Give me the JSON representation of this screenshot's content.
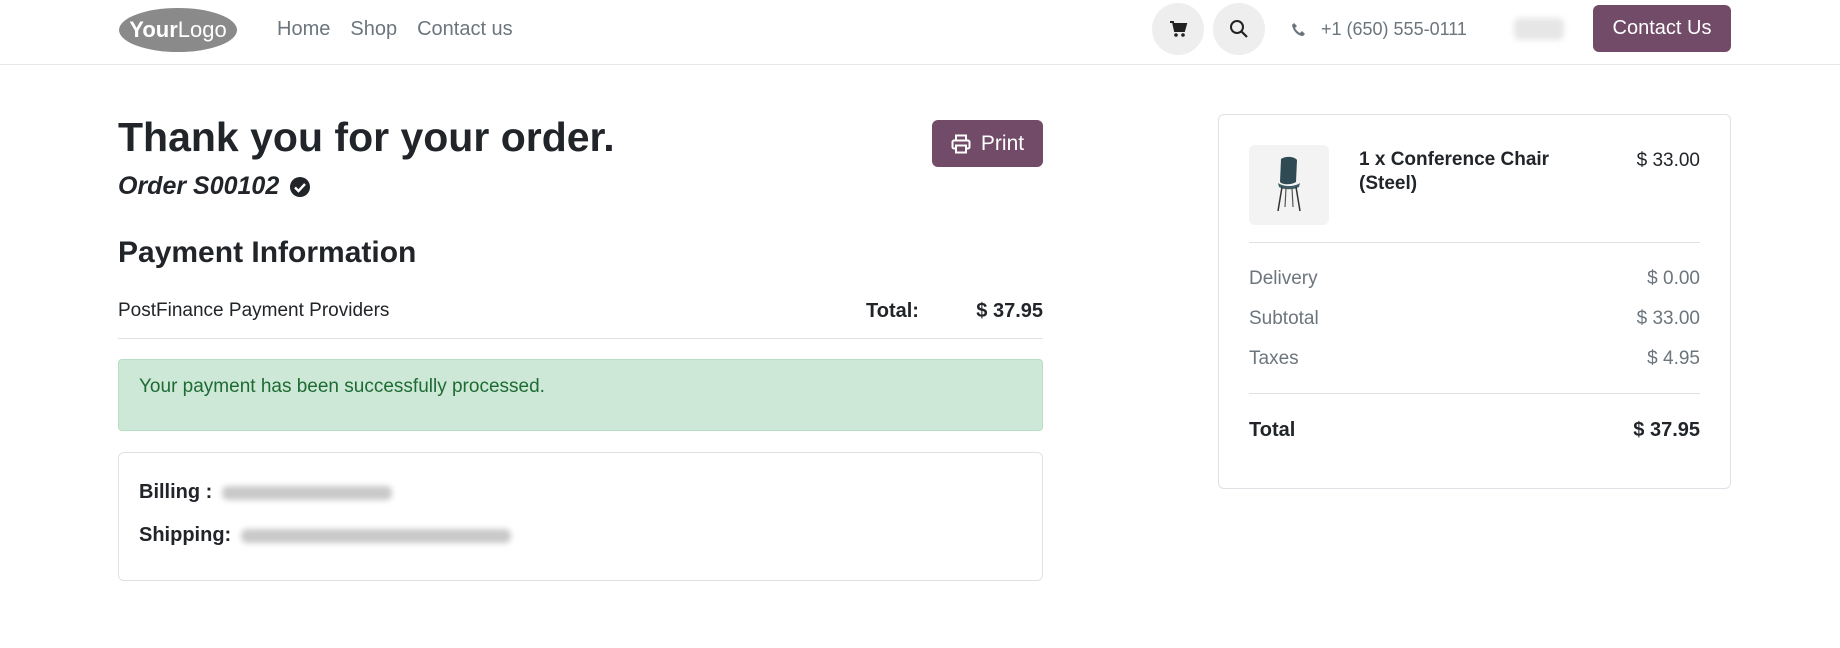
{
  "header": {
    "logo_text": "YourLogo",
    "nav": [
      "Home",
      "Shop",
      "Contact us"
    ],
    "phone": "+1 (650) 555-0111",
    "contact_button": "Contact Us",
    "cart_icon": "cart-icon",
    "search_icon": "search-icon"
  },
  "main": {
    "title": "Thank you for your order.",
    "order_ref": "Order S00102",
    "print_label": "Print",
    "payment_heading": "Payment Information",
    "provider": "PostFinance Payment Providers",
    "total_label": "Total:",
    "total_value": "$ 37.95",
    "alert": "Your payment has been successfully processed.",
    "billing_label": "Billing :",
    "shipping_label": "Shipping:"
  },
  "summary": {
    "item_name": "1 x Conference Chair (Steel)",
    "item_price": "$ 33.00",
    "rows": [
      {
        "label": "Delivery",
        "value": "$ 0.00"
      },
      {
        "label": "Subtotal",
        "value": "$ 33.00"
      },
      {
        "label": "Taxes",
        "value": "$ 4.95"
      }
    ],
    "total_label": "Total",
    "total_value": "$ 37.95"
  },
  "colors": {
    "brand": "#714b67",
    "success_bg": "#cde8d6",
    "success_text": "#1e6b34"
  }
}
